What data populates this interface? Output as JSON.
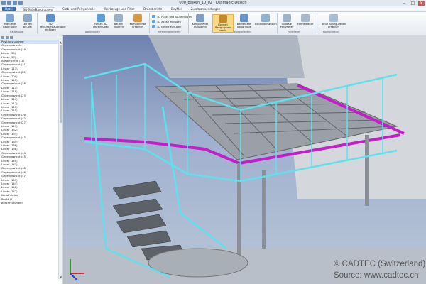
{
  "window": {
    "title": "000_Balken_10_02 - Desmagic Design"
  },
  "tabs": [
    {
      "label": "Datei"
    },
    {
      "label": "3D-Teile/Baugruppen"
    },
    {
      "label": "Stab- und Polygonzeile"
    },
    {
      "label": "Werkzeuge und Filter"
    },
    {
      "label": "Druckbericht"
    },
    {
      "label": "BeyMel"
    },
    {
      "label": "Zusatzanwendungen"
    }
  ],
  "ribbon": {
    "buttons": [
      {
        "label": "Manuelle Baugruppe"
      },
      {
        "label": "3D Teil Bauteil"
      },
      {
        "label": "3D Teil/Unterbaugruppe einfügen"
      },
      {
        "label": "Neues 3D Teil einfügen"
      },
      {
        "label": "Bauteil rotieren"
      },
      {
        "label": "Komponente erstellen"
      },
      {
        "label": "Komponente platzieren"
      },
      {
        "label": "Ebenen Baugruppen bearb."
      },
      {
        "label": "Bedientafel Baugruppe"
      },
      {
        "label": "Explosionsansicht"
      },
      {
        "label": "Globale Parameter"
      },
      {
        "label": "Formeleditor"
      },
      {
        "label": "Neue Konfiguration erstellen"
      }
    ],
    "small_buttons": [
      {
        "label": "3D Punkt und IDU einfügen"
      },
      {
        "label": "3D Achse einfügen"
      },
      {
        "label": "3D Ebene einfügen"
      }
    ],
    "groups": [
      {
        "label": "Baugruppe"
      },
      {
        "label": "Baugruppen"
      },
      {
        "label": "Referenzgeometrie"
      },
      {
        "label": "Komponenten"
      },
      {
        "label": "Parameter"
      },
      {
        "label": "Konfiguration"
      }
    ]
  },
  "tree": {
    "items": [
      "Positionsnummer",
      "Gegengewichte",
      "Gegengewicht (19)",
      "Linear (55)",
      "Linear (57)",
      "Ausgerichtet (14)",
      "Gegengewicht (11)",
      "Linear (113)",
      "Gegengewicht (21)",
      "Linear (100)",
      "Linear (110)",
      "Gegengewicht (38)",
      "Linear (111)",
      "Linear (119)",
      "Gegengewicht (23)",
      "Linear (116)",
      "Linear (117)",
      "Linear (111)",
      "Linear (115)",
      "Gegengewicht (26)",
      "Gegengewicht (42)",
      "Gegengewicht (27)",
      "Linear (129)",
      "Linear (132)",
      "Linear (133)",
      "Gegengewicht (43)",
      "Linear (134)",
      "Linear (136)",
      "Linear (138)",
      "Gegengewicht (44)",
      "Gegengewicht (45)",
      "Linear (140)",
      "Linear (141)",
      "Gegengewicht (48)",
      "Gegengewicht (46)",
      "Gegengewicht (47)",
      "Linear (143)",
      "Linear (144)",
      "Linear (146)",
      "Linear (147)",
      "Konstruktion",
      "",
      "Punkt (1)",
      "",
      "Beschreibungen"
    ]
  },
  "watermark": {
    "line1": "© CADTEC (Switzerland) G",
    "line2": "Source: www.cadtec.ch"
  },
  "colors": {
    "railing": "#5ee0ee",
    "beam": "#c21fc8",
    "ribbon_accent": "#3d6fb0",
    "selected": "#f7d987"
  }
}
